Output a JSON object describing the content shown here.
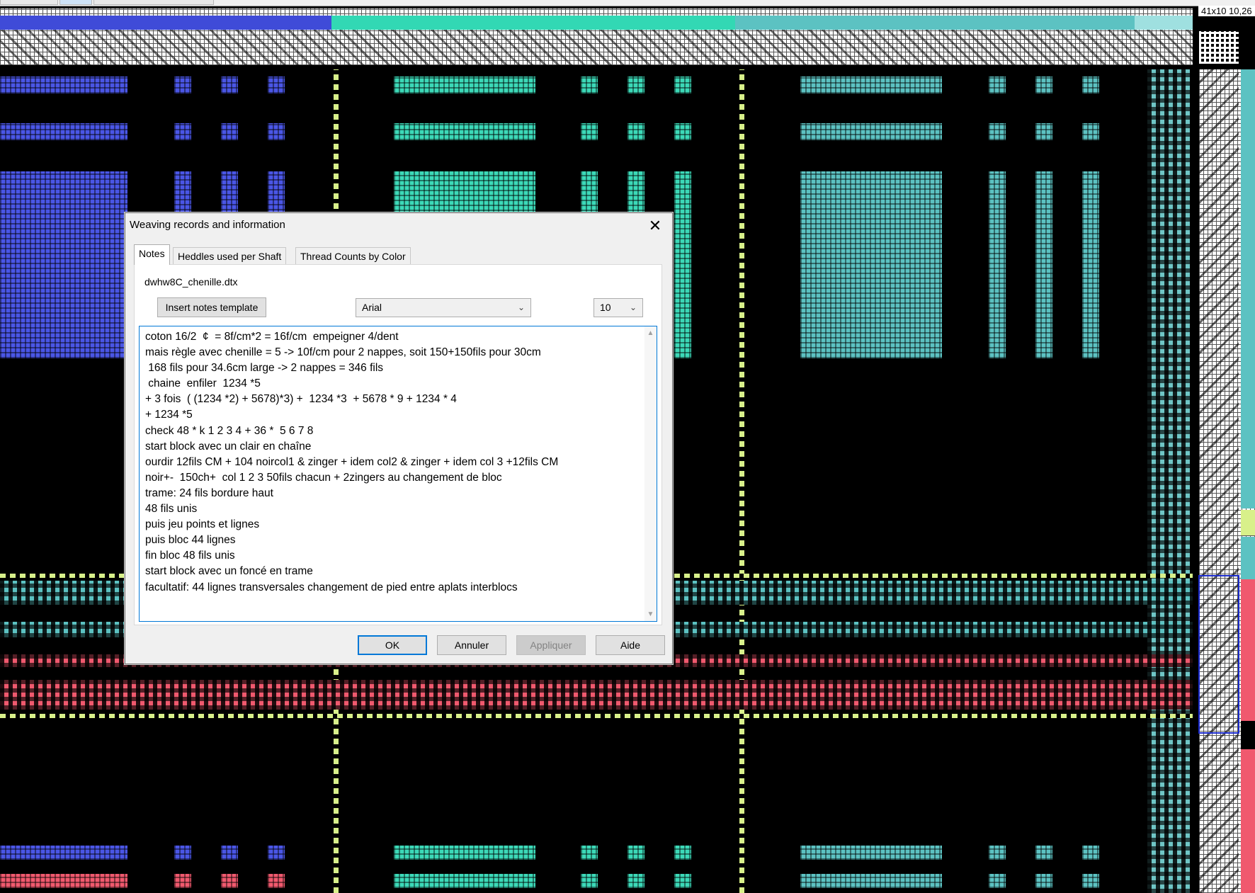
{
  "pattern": {
    "size_label": "41x10 10,26",
    "colors": {
      "blue": "#4a56e6",
      "teal": "#3cd9b8",
      "cyan_grey": "#5cc2c2",
      "yellow_green": "#d8f08a",
      "coral": "#f0596e",
      "black": "#000000"
    }
  },
  "dialog": {
    "title": "Weaving records and information",
    "close_glyph": "✕",
    "tabs": [
      {
        "label": "Notes",
        "active": true
      },
      {
        "label": "Heddles used per Shaft",
        "active": false
      },
      {
        "label": "Thread Counts by Color",
        "active": false
      }
    ],
    "file_name": "dwhw8C_chenille.dtx",
    "insert_template_label": "Insert notes template",
    "font_select": {
      "value": "Arial"
    },
    "size_select": {
      "value": "10"
    },
    "notes_lines": [
      "coton 16/2  ¢  = 8f/cm*2 = 16f/cm  empeigner 4/dent",
      "mais règle avec chenille = 5 -> 10f/cm pour 2 nappes, soit 150+150fils pour 30cm",
      " 168 fils pour 34.6cm large -> 2 nappes = 346 fils",
      " chaine  enfiler  1234 *5",
      "+ 3 fois  ( (1234 *2) + 5678)*3) +  1234 *3  + 5678 * 9 + 1234 * 4",
      "+ 1234 *5",
      "check 48 * k 1 2 3 4 + 36 *  5 6 7 8",
      "start block avec un clair en chaîne",
      "ourdir 12fils CM + 104 noircol1 & zinger + idem col2 & zinger + idem col 3 +12fils CM",
      "noir+-  150ch+  col 1 2 3 50fils chacun + 2zingers au changement de bloc",
      "trame: 24 fils bordure haut",
      "48 fils unis",
      "puis jeu points et lignes",
      "puis bloc 44 lignes",
      "fin bloc 48 fils unis",
      "start block avec un foncé en trame",
      "facultatif: 44 lignes transversales changement de pied entre aplats interblocs"
    ],
    "buttons": {
      "ok": "OK",
      "cancel": "Annuler",
      "apply": "Appliquer",
      "help": "Aide"
    }
  }
}
